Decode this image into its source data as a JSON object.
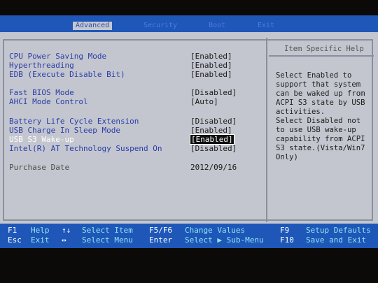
{
  "tabs": [
    "Advanced",
    "Security",
    "Boot",
    "Exit"
  ],
  "settings": [
    {
      "label": "CPU Power Saving Mode",
      "value": "[Enabled]"
    },
    {
      "label": "Hyperthreading",
      "value": "[Enabled]"
    },
    {
      "label": "EDB (Execute Disable Bit)",
      "value": "[Enabled]"
    },
    {
      "label": "Fast BIOS Mode",
      "value": "[Disabled]"
    },
    {
      "label": "AHCI Mode Control",
      "value": "[Auto]"
    },
    {
      "label": "Battery Life Cycle Extension",
      "value": "[Disabled]"
    },
    {
      "label": "USB Charge In Sleep Mode",
      "value": "[Enabled]"
    },
    {
      "label": "USB S3 Wake-up",
      "value": "[Enabled]"
    },
    {
      "label": "Intel(R) AT Technology Suspend On",
      "value": "[Disabled]"
    },
    {
      "label": "Purchase Date",
      "value": "2012/09/16"
    }
  ],
  "help": {
    "title": "Item Specific Help",
    "text": "Select Enabled to\nsupport that system\ncan be waked up from\nACPI S3 state by USB\nactivities.\nSelect Disabled not\nto use USB wake-up\ncapability from ACPI\nS3 state.(Vista/Win7\nOnly)"
  },
  "footer": {
    "f1_key": "F1",
    "f1_desc": "Help",
    "esc_key": "Esc",
    "esc_desc": "Exit",
    "updown_key": "↑↓",
    "updown_desc": "Select Item",
    "lr_key": "↔",
    "lr_desc": "Select Menu",
    "f5f6_key": "F5/F6",
    "f5f6_desc": "Change Values",
    "enter_key": "Enter",
    "enter_desc": "Select ▶ Sub-Menu",
    "f9_key": "F9",
    "f9_desc": "Setup Defaults",
    "f10_key": "F10",
    "f10_desc": "Save and Exit"
  }
}
